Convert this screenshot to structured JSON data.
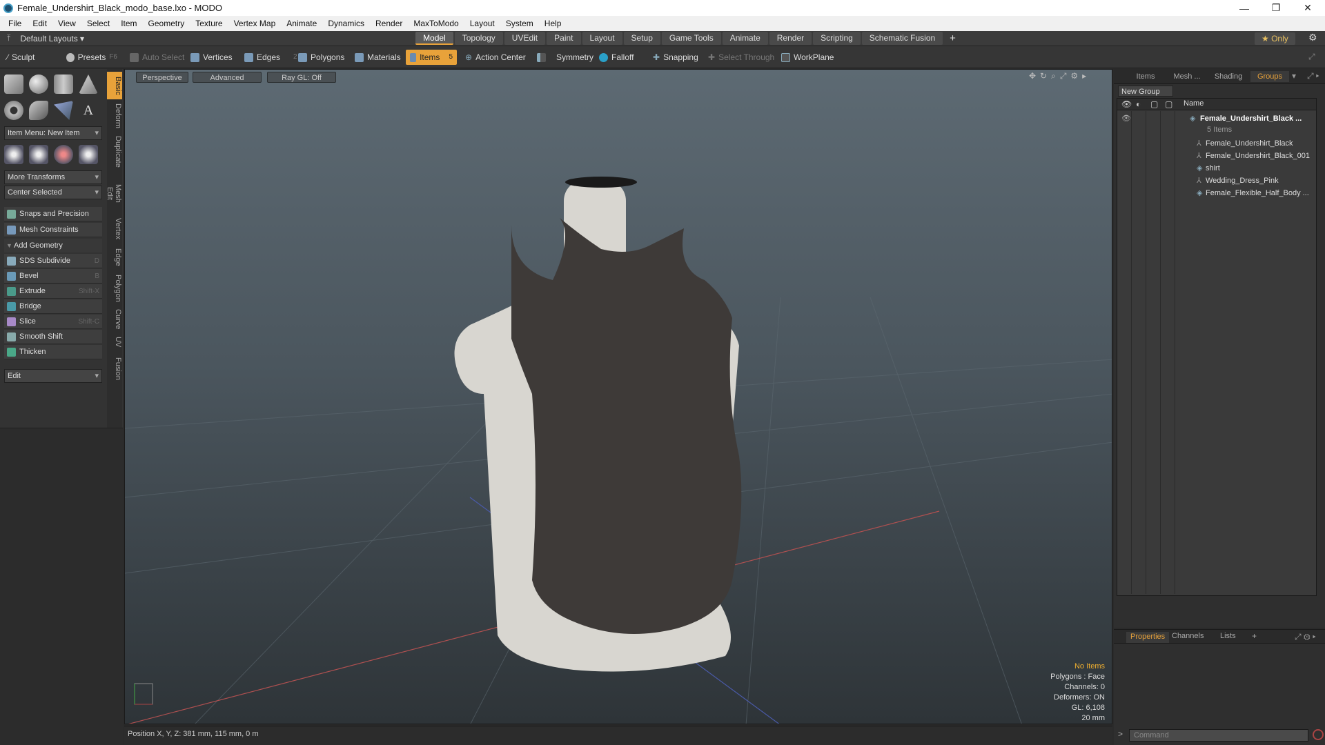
{
  "window": {
    "title": "Female_Undershirt_Black_modo_base.lxo - MODO",
    "minimize": "—",
    "maximize": "❐",
    "close": "✕"
  },
  "menu": [
    "File",
    "Edit",
    "View",
    "Select",
    "Item",
    "Geometry",
    "Texture",
    "Vertex Map",
    "Animate",
    "Dynamics",
    "Render",
    "MaxToModo",
    "Layout",
    "System",
    "Help"
  ],
  "layoutbar": {
    "layouts": "Default Layouts ▾",
    "tabs": [
      "Model",
      "Topology",
      "UVEdit",
      "Paint",
      "Layout",
      "Setup",
      "Game Tools",
      "Animate",
      "Render",
      "Scripting",
      "Schematic Fusion"
    ],
    "active": "Model",
    "add": "+",
    "only": "★ Only"
  },
  "toolbar": {
    "sculpt": "Sculpt",
    "presets": "Presets",
    "presets_key": "F6",
    "auto_select": "Auto Select",
    "vertices": "Vertices",
    "vertices_num": "1",
    "edges": "Edges",
    "edges_num": "2",
    "polygons": "Polygons",
    "materials": "Materials",
    "items": "Items",
    "items_num": "5",
    "action_center": "Action Center",
    "symmetry": "Symmetry",
    "falloff": "Falloff",
    "snapping": "Snapping",
    "select_through": "Select Through",
    "workplane": "WorkPlane"
  },
  "leftpanel": {
    "item_menu": "Item Menu: New Item",
    "more_transforms": "More Transforms",
    "center_selected": "Center Selected",
    "snaps": "Snaps and Precision",
    "constraints": "Mesh Constraints",
    "add_geometry": "Add Geometry",
    "tools": [
      {
        "label": "SDS Subdivide",
        "key": "D"
      },
      {
        "label": "Bevel",
        "key": "B"
      },
      {
        "label": "Extrude",
        "key": "Shift-X"
      },
      {
        "label": "Bridge",
        "key": ""
      },
      {
        "label": "Slice",
        "key": "Shift-C"
      },
      {
        "label": "Smooth Shift",
        "key": ""
      },
      {
        "label": "Thicken",
        "key": ""
      }
    ],
    "edit": "Edit",
    "vtabs": [
      "Basic",
      "Deform",
      "Duplicate",
      "Mesh Edit",
      "Vertex",
      "Edge",
      "Polygon",
      "Curve",
      "UV",
      "Fusion"
    ]
  },
  "viewport": {
    "perspective": "Perspective",
    "advanced": "Advanced",
    "raygl": "Ray GL: Off",
    "info": {
      "no_items": "No Items",
      "polygons": "Polygons : Face",
      "channels": "Channels: 0",
      "deformers": "Deformers: ON",
      "gl": "GL: 6,108",
      "scale": "20 mm"
    }
  },
  "rightpanel": {
    "tabs": [
      "Items",
      "Mesh ...",
      "Shading",
      "Groups"
    ],
    "active_tab": "Groups",
    "new_group": "New Group",
    "col_name": "Name",
    "group_name": "Female_Undershirt_Black ...",
    "group_count": "5 Items",
    "items": [
      "Female_Undershirt_Black",
      "Female_Undershirt_Black_001",
      "shirt",
      "Wedding_Dress_Pink",
      "Female_Flexible_Half_Body ..."
    ],
    "bottom_tabs": [
      "Properties",
      "Channels",
      "Lists",
      "+"
    ],
    "command_placeholder": "Command"
  },
  "status": "Position X, Y, Z:   381 mm, 115 mm, 0 m",
  "colors": {
    "accent": "#e8a23a",
    "viewport_top": "#5d6a73",
    "shirt": "#3e3a38",
    "mannequin": "#d8d6d0"
  }
}
